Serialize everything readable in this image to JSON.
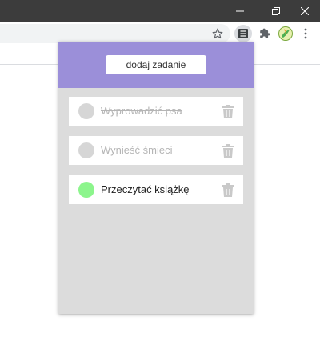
{
  "browser": {
    "titlebar_color": "#3c3c3c",
    "window_controls": [
      "minimize-icon",
      "restore-icon",
      "close-icon"
    ],
    "toolbar_icons": [
      "star-icon",
      "todo-extension-icon",
      "puzzle-extensions-icon",
      "profile-avatar-icon",
      "more-menu-icon"
    ]
  },
  "popup": {
    "header_color": "#9b8fd9",
    "add_button_label": "dodaj zadanie",
    "tasks": [
      {
        "label": "Wyprowadzić psa",
        "completed": true
      },
      {
        "label": "Wynieść śmieci",
        "completed": true
      },
      {
        "label": "Przeczytać książkę",
        "completed": false
      }
    ],
    "completed_color": "#b5b5b5",
    "check_active_color": "#8cf58c"
  }
}
